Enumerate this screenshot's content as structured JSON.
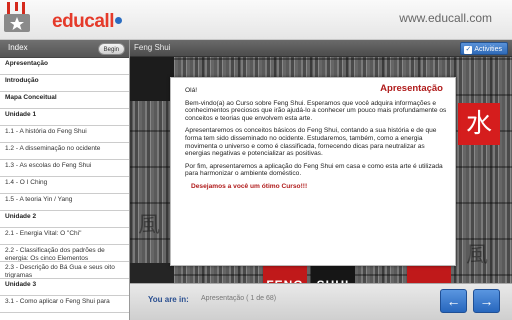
{
  "header": {
    "logo_text": "educall",
    "url": "www.educall.com"
  },
  "sidebar": {
    "title": "Index",
    "begin_label": "Begin",
    "items": [
      {
        "label": "Apresentação",
        "bold": true
      },
      {
        "label": "Introdução",
        "bold": true
      },
      {
        "label": "Mapa Conceitual",
        "bold": true
      },
      {
        "label": "Unidade 1",
        "bold": true
      },
      {
        "label": "1.1 - A história do Feng Shui",
        "bold": false
      },
      {
        "label": "1.2 - A disseminação no ocidente",
        "bold": false
      },
      {
        "label": "1.3 - As escolas do Feng Shui",
        "bold": false
      },
      {
        "label": "1.4 - O I Ching",
        "bold": false
      },
      {
        "label": "1.5 - A teoria Yin / Yang",
        "bold": false
      },
      {
        "label": "Unidade 2",
        "bold": true
      },
      {
        "label": "2.1 - Energia Vital: O \"Chi\"",
        "bold": false
      },
      {
        "label": "2.2 - Classificação dos padrões de energia: Os cinco Elementos",
        "bold": false
      },
      {
        "label": "2.3 - Descrição do Bá Gua e seus oito trigramas",
        "bold": false
      },
      {
        "label": "Unidade 3",
        "bold": true
      },
      {
        "label": "3.1 - Como aplicar o Feng Shui para",
        "bold": false
      }
    ]
  },
  "main": {
    "title": "Feng Shui",
    "activities_label": "Activities"
  },
  "panel": {
    "title": "Apresentação",
    "greeting": "Olá!",
    "p1": "Bem-vindo(a) ao Curso sobre Feng Shui. Esperamos que você adquira informações e conhecimentos preciosos que irão ajudá-lo a conhecer um pouco mais profundamente os conceitos e teorias que envolvem esta arte.",
    "p2": "Apresentaremos os conceitos básicos do Feng Shui, contando a sua história e de que forma tem sido disseminado no ocidente. Estudaremos, também, como a energia movimenta o universo e como é classificada, fornecendo dicas para neutralizar as energias negativas e potencializar as positivas.",
    "p3": "Por fim, apresentaremos a aplicação do Feng Shui em casa e como esta arte é utilizada para harmonizar o ambiente doméstico.",
    "closing": "Desejamos a você um ótimo Curso!!!"
  },
  "tiles": {
    "kanji_water": "水",
    "kanji_wind": "風",
    "feng": "FENG",
    "shui": "SHUI"
  },
  "footer": {
    "you_are_in_label": "You are in:",
    "location": "Apresentação  ( 1  de  68)",
    "prev_icon": "←",
    "next_icon": "→"
  },
  "colors": {
    "accent_red": "#b01c1c",
    "button_blue": "#2f6ab8"
  }
}
